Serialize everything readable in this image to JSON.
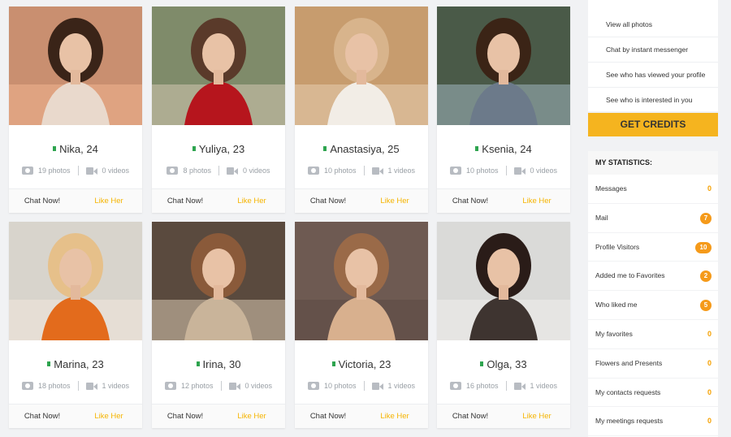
{
  "profiles": [
    {
      "name_age": "Nika, 24",
      "photos": "19 photos",
      "videos": "0 videos",
      "chat": "Chat Now!",
      "like": "Like Her",
      "photo_icon": "camera-icon",
      "video_icon": "video-camera-icon"
    },
    {
      "name_age": "Yuliya, 23",
      "photos": "8 photos",
      "videos": "0 videos",
      "chat": "Chat Now!",
      "like": "Like Her",
      "photo_icon": "camera-icon",
      "video_icon": "video-camera-icon"
    },
    {
      "name_age": "Anastasiya, 25",
      "photos": "10 photos",
      "videos": "1 videos",
      "chat": "Chat Now!",
      "like": "Like Her",
      "photo_icon": "camera-icon",
      "video_icon": "video-camera-icon"
    },
    {
      "name_age": "Ksenia, 24",
      "photos": "10 photos",
      "videos": "0 videos",
      "chat": "Chat Now!",
      "like": "Like Her",
      "photo_icon": "camera-icon",
      "video_icon": "video-camera-icon"
    },
    {
      "name_age": "Marina, 23",
      "photos": "18 photos",
      "videos": "1 videos",
      "chat": "Chat Now!",
      "like": "Like Her",
      "photo_icon": "camera-icon",
      "video_icon": "video-camera-icon"
    },
    {
      "name_age": "Irina, 30",
      "photos": "12 photos",
      "videos": "0 videos",
      "chat": "Chat Now!",
      "like": "Like Her",
      "photo_icon": "camera-icon",
      "video_icon": "video-camera-icon"
    },
    {
      "name_age": "Victoria, 23",
      "photos": "10 photos",
      "videos": "1 videos",
      "chat": "Chat Now!",
      "like": "Like Her",
      "photo_icon": "camera-icon",
      "video_icon": "video-camera-icon"
    },
    {
      "name_age": "Olga, 33",
      "photos": "16 photos",
      "videos": "1 videos",
      "chat": "Chat Now!",
      "like": "Like Her",
      "photo_icon": "camera-icon",
      "video_icon": "video-camera-icon"
    }
  ],
  "sidebar": {
    "menu": [
      {
        "label": "View all photos"
      },
      {
        "label": "Chat by instant messenger"
      },
      {
        "label": "See who has viewed your profile"
      },
      {
        "label": "See who is interested in you"
      }
    ],
    "credits_button": "GET CREDITS",
    "stats_title": "MY STATISTICS:",
    "stats": [
      {
        "label": "Messages",
        "count": "0",
        "badge": false
      },
      {
        "label": "Mail",
        "count": "7",
        "badge": true
      },
      {
        "label": "Profile Visitors",
        "count": "10",
        "badge": true
      },
      {
        "label": "Added me to Favorites",
        "count": "2",
        "badge": true
      },
      {
        "label": "Who liked me",
        "count": "5",
        "badge": true
      },
      {
        "label": "My favorites",
        "count": "0",
        "badge": false
      },
      {
        "label": "Flowers and Presents",
        "count": "0",
        "badge": false
      },
      {
        "label": "My contacts requests",
        "count": "0",
        "badge": false
      },
      {
        "label": "My meetings requests",
        "count": "0",
        "badge": false
      }
    ]
  },
  "colors": {
    "accent": "#f5b41f",
    "like": "#f5b400",
    "badge": "#f59a1a",
    "online": "#2ea44f",
    "background": "#f1f2f4"
  }
}
